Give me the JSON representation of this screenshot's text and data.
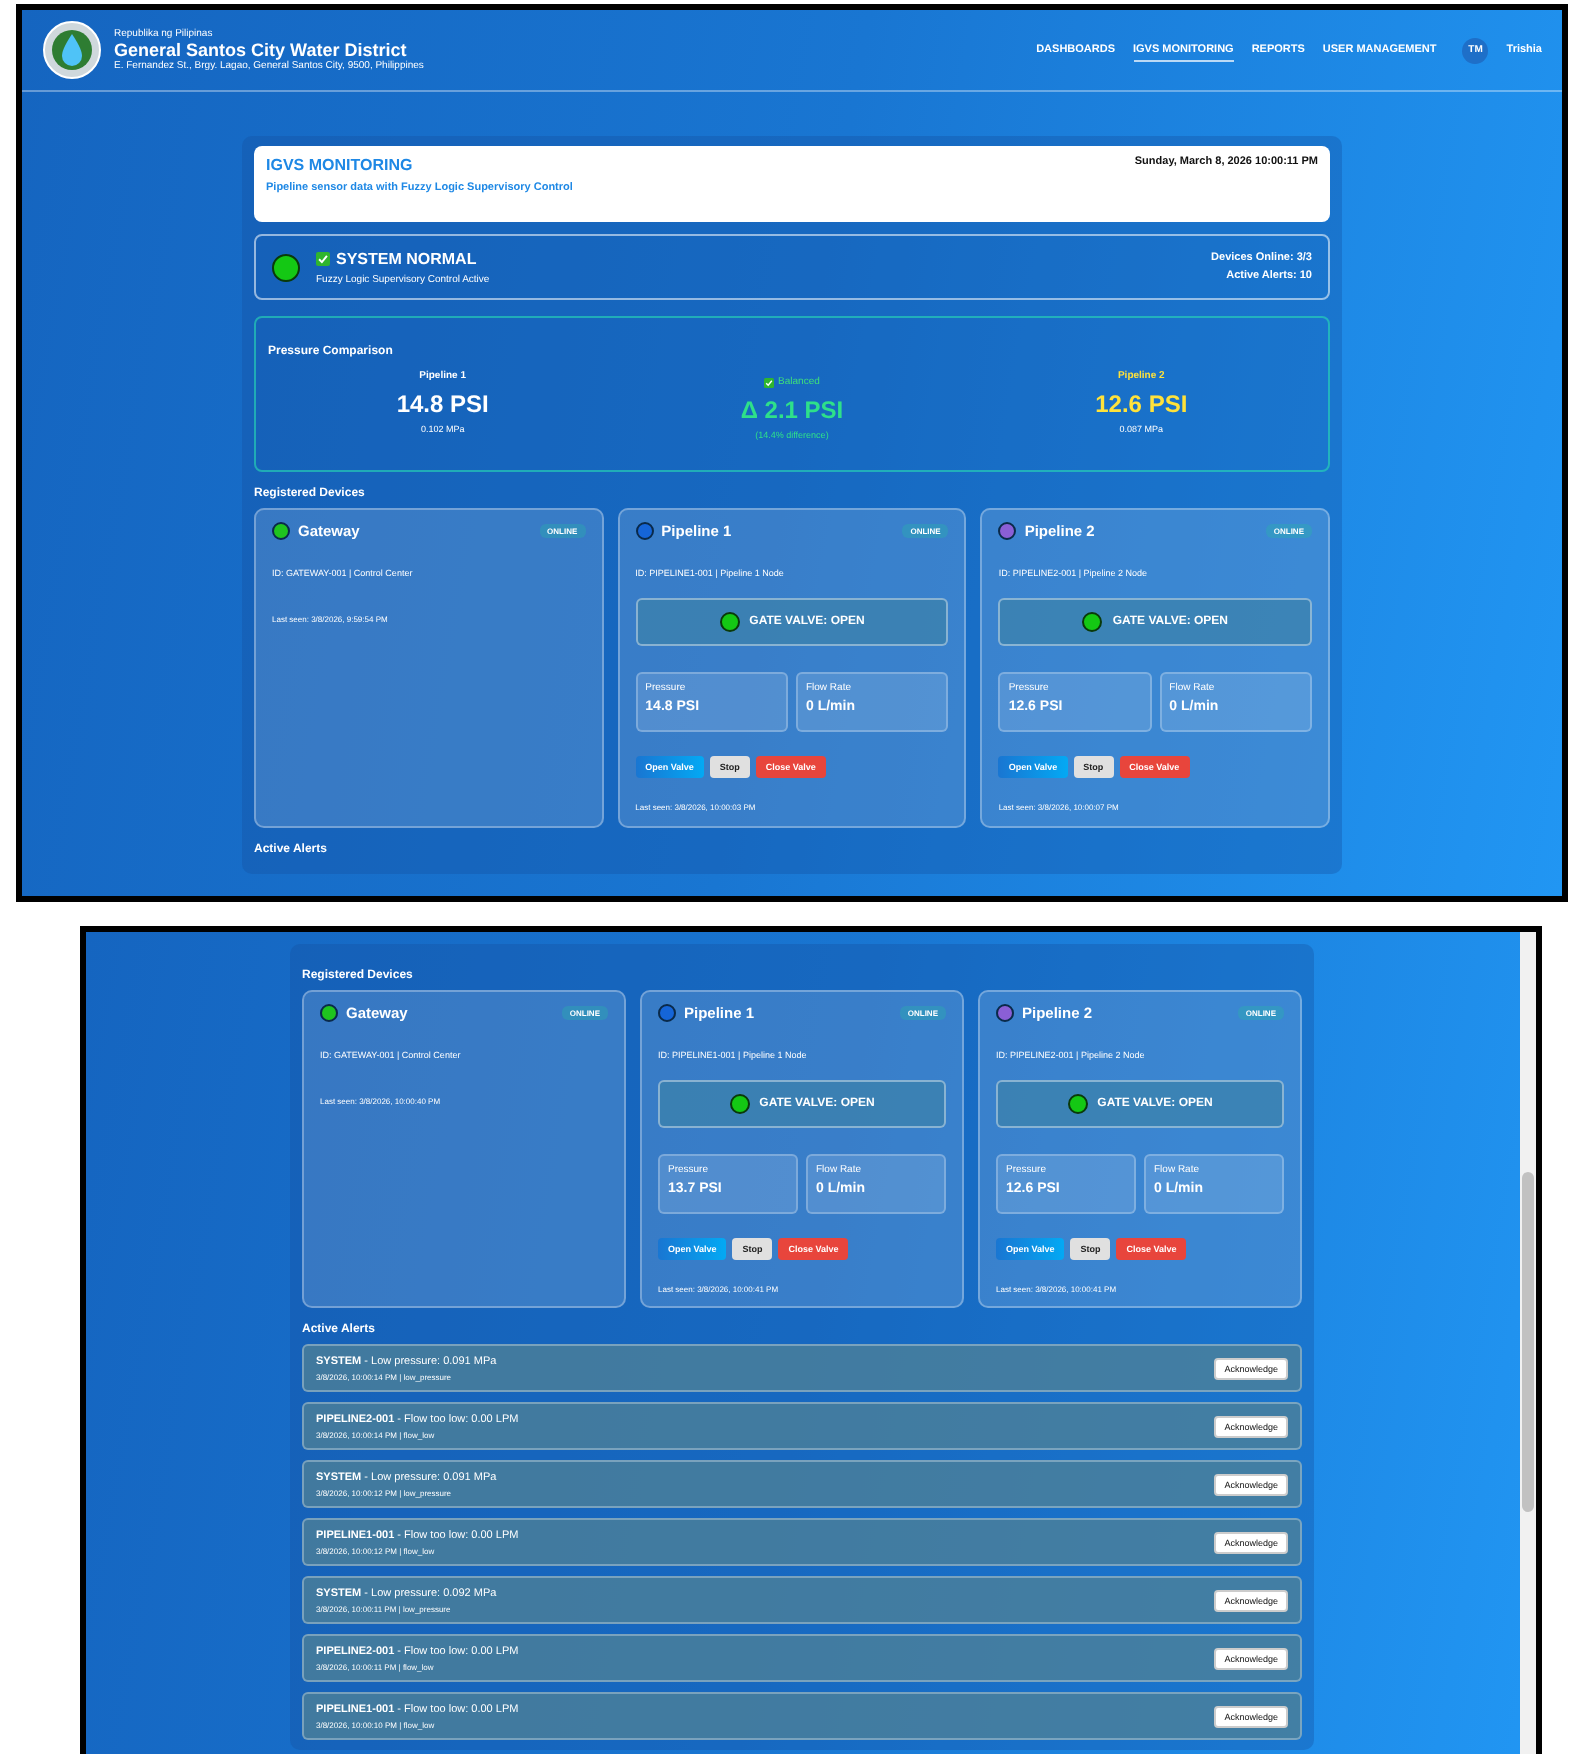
{
  "top_screenshot": {
    "header": {
      "overline": "Republika ng Pilipinas",
      "title": "General Santos City Water District",
      "address": "E. Fernandez St., Brgy. Lagao, General Santos City, 9500, Philippines",
      "nav": [
        {
          "label": "DASHBOARDS",
          "selected": false
        },
        {
          "label": "IGVS MONITORING",
          "selected": true
        },
        {
          "label": "REPORTS",
          "selected": false
        },
        {
          "label": "USER MANAGEMENT",
          "selected": false
        }
      ],
      "user": {
        "initials": "TM",
        "name": "Trishia"
      }
    },
    "page_header": {
      "title": "IGVS MONITORING",
      "subtitle": "Pipeline sensor data with Fuzzy Logic Supervisory Control",
      "datetime": "Sunday, March 8, 2026 10:00:11 PM"
    },
    "system_status": {
      "title": "SYSTEM NORMAL",
      "subtitle": "Fuzzy Logic Supervisory Control Active",
      "devices_online": "Devices Online: 3/3",
      "active_alerts": "Active Alerts: 10"
    },
    "pressure_comparison": {
      "title": "Pressure Comparison",
      "left": {
        "label": "Pipeline 1",
        "value": "14.8 PSI",
        "mpa": "0.102 MPa"
      },
      "center": {
        "status": "Balanced",
        "delta": "Δ 2.1 PSI",
        "difference": "(14.4% difference)"
      },
      "right": {
        "label": "Pipeline 2",
        "value": "12.6 PSI",
        "mpa": "0.087 MPa"
      }
    },
    "devices_title": "Registered Devices",
    "devices": [
      {
        "kind": "gateway",
        "name": "Gateway",
        "color": "#1fc41f",
        "status": "ONLINE",
        "id_line": "ID: GATEWAY-001 | Control Center",
        "last_seen": "Last seen: 3/8/2026, 9:59:54 PM"
      },
      {
        "kind": "pipeline",
        "name": "Pipeline 1",
        "color": "#1565d8",
        "status": "ONLINE",
        "id_line": "ID: PIPELINE1-001 | Pipeline 1 Node",
        "valve": "GATE VALVE: OPEN",
        "pressure_label": "Pressure",
        "pressure": "14.8 PSI",
        "flow_label": "Flow Rate",
        "flow": "0 L/min",
        "buttons": [
          "Open Valve",
          "Stop",
          "Close Valve"
        ],
        "last_seen": "Last seen: 3/8/2026, 10:00:03 PM"
      },
      {
        "kind": "pipeline",
        "name": "Pipeline 2",
        "color": "#8a5fd6",
        "status": "ONLINE",
        "id_line": "ID: PIPELINE2-001 | Pipeline 2 Node",
        "valve": "GATE VALVE: OPEN",
        "pressure_label": "Pressure",
        "pressure": "12.6 PSI",
        "flow_label": "Flow Rate",
        "flow": "0 L/min",
        "buttons": [
          "Open Valve",
          "Stop",
          "Close Valve"
        ],
        "last_seen": "Last seen: 3/8/2026, 10:00:07 PM"
      }
    ],
    "alerts_title": "Active Alerts"
  },
  "bottom_screenshot": {
    "devices_title": "Registered Devices",
    "devices": [
      {
        "kind": "gateway",
        "name": "Gateway",
        "color": "#1fc41f",
        "status": "ONLINE",
        "id_line": "ID: GATEWAY-001 | Control Center",
        "last_seen": "Last seen: 3/8/2026, 10:00:40 PM"
      },
      {
        "kind": "pipeline",
        "name": "Pipeline 1",
        "color": "#1565d8",
        "status": "ONLINE",
        "id_line": "ID: PIPELINE1-001 | Pipeline 1 Node",
        "valve": "GATE VALVE: OPEN",
        "pressure_label": "Pressure",
        "pressure": "13.7 PSI",
        "flow_label": "Flow Rate",
        "flow": "0 L/min",
        "buttons": [
          "Open Valve",
          "Stop",
          "Close Valve"
        ],
        "last_seen": "Last seen: 3/8/2026, 10:00:41 PM"
      },
      {
        "kind": "pipeline",
        "name": "Pipeline 2",
        "color": "#8a5fd6",
        "status": "ONLINE",
        "id_line": "ID: PIPELINE2-001 | Pipeline 2 Node",
        "valve": "GATE VALVE: OPEN",
        "pressure_label": "Pressure",
        "pressure": "12.6 PSI",
        "flow_label": "Flow Rate",
        "flow": "0 L/min",
        "buttons": [
          "Open Valve",
          "Stop",
          "Close Valve"
        ],
        "last_seen": "Last seen: 3/8/2026, 10:00:41 PM"
      }
    ],
    "alerts_title": "Active Alerts",
    "alerts": [
      {
        "source": "SYSTEM",
        "message": " - Low pressure: 0.091 MPa",
        "meta": "3/8/2026, 10:00:14 PM | low_pressure",
        "action": "Acknowledge"
      },
      {
        "source": "PIPELINE2-001",
        "message": " - Flow too low: 0.00 LPM",
        "meta": "3/8/2026, 10:00:14 PM | flow_low",
        "action": "Acknowledge"
      },
      {
        "source": "SYSTEM",
        "message": " - Low pressure: 0.091 MPa",
        "meta": "3/8/2026, 10:00:12 PM | low_pressure",
        "action": "Acknowledge"
      },
      {
        "source": "PIPELINE1-001",
        "message": " - Flow too low: 0.00 LPM",
        "meta": "3/8/2026, 10:00:12 PM | flow_low",
        "action": "Acknowledge"
      },
      {
        "source": "SYSTEM",
        "message": " - Low pressure: 0.092 MPa",
        "meta": "3/8/2026, 10:00:11 PM | low_pressure",
        "action": "Acknowledge"
      },
      {
        "source": "PIPELINE2-001",
        "message": " - Flow too low: 0.00 LPM",
        "meta": "3/8/2026, 10:00:11 PM | flow_low",
        "action": "Acknowledge"
      },
      {
        "source": "PIPELINE1-001",
        "message": " - Flow too low: 0.00 LPM",
        "meta": "3/8/2026, 10:00:10 PM | flow_low",
        "action": "Acknowledge"
      }
    ]
  }
}
